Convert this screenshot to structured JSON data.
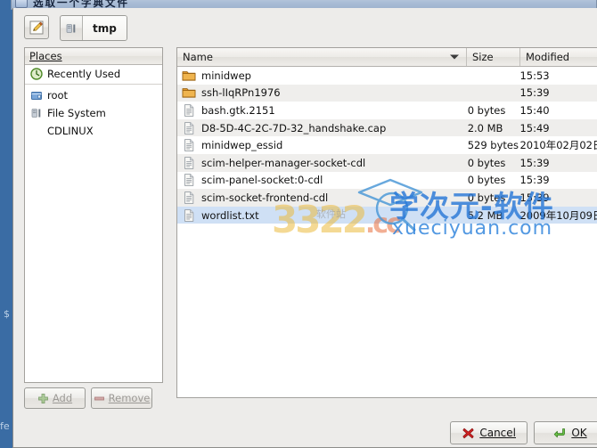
{
  "window": {
    "title": "选取一个字典文件",
    "icon": "window-icon"
  },
  "toolbar": {
    "create_folder_icon": "pencil-edit-icon",
    "path_root_icon": "filesystem-icon",
    "path_current": "tmp"
  },
  "places": {
    "header": "Places",
    "items": [
      {
        "label": "Recently Used",
        "icon": "recent-clock-icon",
        "indent": false
      },
      {
        "label": "root",
        "icon": "home-folder-icon",
        "indent": false
      },
      {
        "label": "File System",
        "icon": "filesystem-icon",
        "indent": false
      },
      {
        "label": "CDLINUX",
        "icon": "none",
        "indent": true
      }
    ],
    "add_label": "Add",
    "add_accel": "A",
    "remove_label": "Remove",
    "remove_accel": "R",
    "add_icon": "plus-icon",
    "remove_icon": "minus-icon"
  },
  "file_list": {
    "columns": [
      "Name",
      "Size",
      "Modified"
    ],
    "sort_column": "Name",
    "sort_direction": "descending",
    "rows": [
      {
        "name": "minidwep",
        "size": "",
        "modified": "15:53",
        "type": "folder",
        "selected": false
      },
      {
        "name": "ssh-lIqRPn1976",
        "size": "",
        "modified": "15:39",
        "type": "folder",
        "selected": false
      },
      {
        "name": "bash.gtk.2151",
        "size": "0 bytes",
        "modified": "15:40",
        "type": "file",
        "selected": false
      },
      {
        "name": "D8-5D-4C-2C-7D-32_handshake.cap",
        "size": "2.0 MB",
        "modified": "15:49",
        "type": "file",
        "selected": false
      },
      {
        "name": "minidwep_essid",
        "size": "529 bytes",
        "modified": "2010年02月02日",
        "type": "file",
        "selected": false
      },
      {
        "name": "scim-helper-manager-socket-cdl",
        "size": "0 bytes",
        "modified": "15:39",
        "type": "file",
        "selected": false
      },
      {
        "name": "scim-panel-socket:0-cdl",
        "size": "0 bytes",
        "modified": "15:39",
        "type": "file",
        "selected": false
      },
      {
        "name": "scim-socket-frontend-cdl",
        "size": "0 bytes",
        "modified": "15:39",
        "type": "file",
        "selected": false
      },
      {
        "name": "wordlist.txt",
        "size": "5.2 MB",
        "modified": "2009年10月09日",
        "type": "file",
        "selected": true
      }
    ]
  },
  "actions": {
    "cancel_label": "Cancel",
    "cancel_accel": "C",
    "cancel_icon": "red-x-icon",
    "ok_label": "OK",
    "ok_accel": "O",
    "ok_icon": "green-check-icon"
  },
  "background": {
    "fragment_left_top": "$",
    "fragment_left_bottom": "fe"
  },
  "watermarks": {
    "site_cn": "学次元-软件",
    "site_url": "xueciyuan.com",
    "secondary": "3322",
    "secondary_suffix": ".cc",
    "secondary_small": "软件站"
  },
  "colors": {
    "desktop": "#3f72ab",
    "dialog_bg": "#edecea",
    "selection": "#cfe0f5",
    "accent_blue": "#2878d7",
    "folder": "#e8a33d"
  }
}
